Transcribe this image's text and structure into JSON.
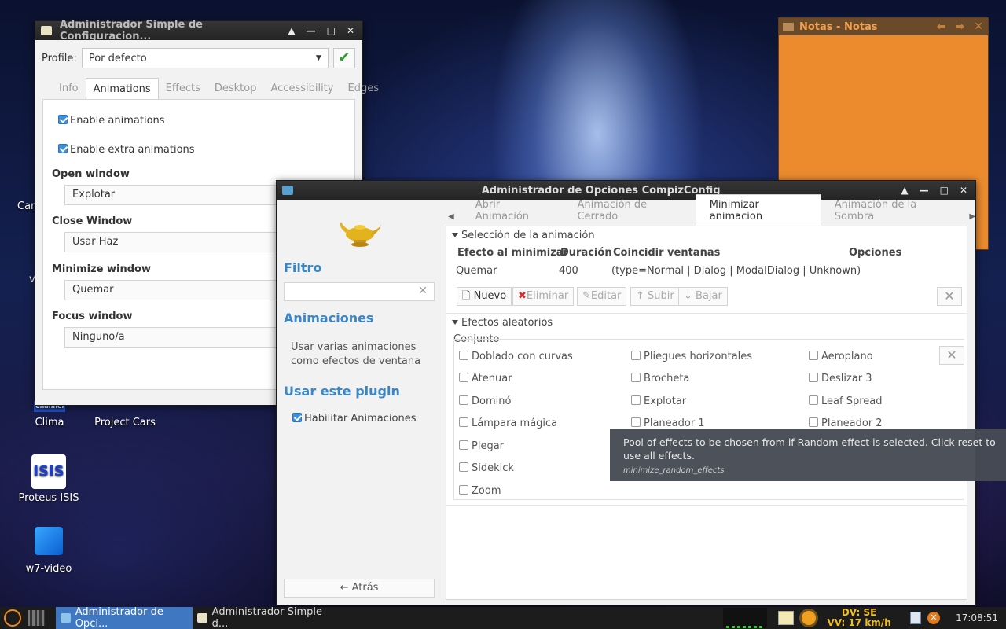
{
  "desktop": {
    "icons": [
      {
        "label": "Clima"
      },
      {
        "label": "Project Cars"
      },
      {
        "label": "Proteus ISIS",
        "glyph": "ISIS"
      },
      {
        "label": "w7-video"
      }
    ],
    "partial": [
      "Car",
      "v",
      "Channel"
    ]
  },
  "simple_window": {
    "title": "Administrador Simple de Configuracion...",
    "profile_label": "Profile:",
    "profile_value": "Por defecto",
    "tabs": [
      "Info",
      "Animations",
      "Effects",
      "Desktop",
      "Accessibility",
      "Edges"
    ],
    "enable_animations": "Enable animations",
    "enable_extra": "Enable extra animations",
    "open_window_label": "Open window",
    "open_window_value": "Explotar",
    "close_window_label": "Close Window",
    "close_window_value": "Usar Haz",
    "minimize_window_label": "Minimize window",
    "minimize_window_value": "Quemar",
    "focus_window_label": "Focus window",
    "focus_window_value": "Ninguno/a"
  },
  "notas": {
    "title": "Notas - Notas"
  },
  "compiz": {
    "title": "Administrador de Opciones CompizConfig",
    "filter_heading": "Filtro",
    "anim_heading": "Animaciones",
    "anim_desc": "Usar varias animaciones como efectos de ventana",
    "use_plugin_heading": "Usar este plugin",
    "enable_plugin": "Habilitar Animaciones",
    "back_button": "← Atrás",
    "tabs": [
      "Abrir Animación",
      "Animación de Cerrado",
      "Minimizar animacion",
      "Animación de la Sombra"
    ],
    "section_selection": "Selección de la animación",
    "columns": [
      "Efecto al minimizar",
      "Duración",
      "Coincidir ventanas",
      "Opciones"
    ],
    "row": {
      "effect": "Quemar",
      "duration": "400",
      "match": "(type=Normal | Dialog | ModalDialog | Unknown)"
    },
    "buttons": {
      "new": "Nuevo",
      "delete": "Eliminar",
      "edit": "Editar",
      "up": "Subir",
      "down": "Bajar"
    },
    "section_random": "Efectos aleatorios",
    "set_label": "Conjunto",
    "effects_col1": [
      "Doblado con curvas",
      "Atenuar",
      "Dominó",
      "Lámpara mágica",
      "Plegar",
      "Sidekick",
      "Zoom"
    ],
    "effects_col2": [
      "Pliegues horizontales",
      "Brocheta",
      "Explotar",
      "Planeador 1"
    ],
    "effects_col3": [
      "Aeroplano",
      "Deslizar 3",
      "Leaf Spread",
      "Planeador 2"
    ]
  },
  "tooltip": {
    "text": "Pool of effects to be chosen from if Random effect is selected. Click reset to use all effects.",
    "key": "minimize_random_effects"
  },
  "taskbar": {
    "task1": "Administrador de Opci...",
    "task2": "Administrador Simple d...",
    "weather_dv": "DV: SE",
    "weather_vv": "VV: 17 km/h",
    "clock": "17:08:51"
  },
  "colors": {
    "accent": "#3a87c8",
    "taskbar_active": "#3f78c0",
    "notes": "#ec8b2e"
  }
}
